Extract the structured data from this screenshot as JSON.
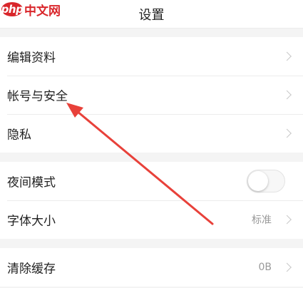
{
  "watermark": {
    "logo_text": "php",
    "site_text": "中文网",
    "color": "#d9262b"
  },
  "header": {
    "title": "设置"
  },
  "sections": {
    "account": {
      "edit_profile": {
        "label": "编辑资料",
        "icon": "chevron-right-icon"
      },
      "account_security": {
        "label": "帐号与安全",
        "icon": "chevron-right-icon"
      },
      "privacy": {
        "label": "隐私",
        "icon": "chevron-right-icon"
      }
    },
    "display": {
      "night_mode": {
        "label": "夜间模式",
        "toggle_on": false
      },
      "font_size": {
        "label": "字体大小",
        "value": "标准",
        "icon": "chevron-right-icon"
      }
    },
    "storage": {
      "clear_cache": {
        "label": "清除缓存",
        "value": "0B",
        "icon": "chevron-right-icon"
      }
    }
  },
  "annotation": {
    "type": "arrow",
    "color": "#e8413a",
    "points_to": "account_security"
  }
}
